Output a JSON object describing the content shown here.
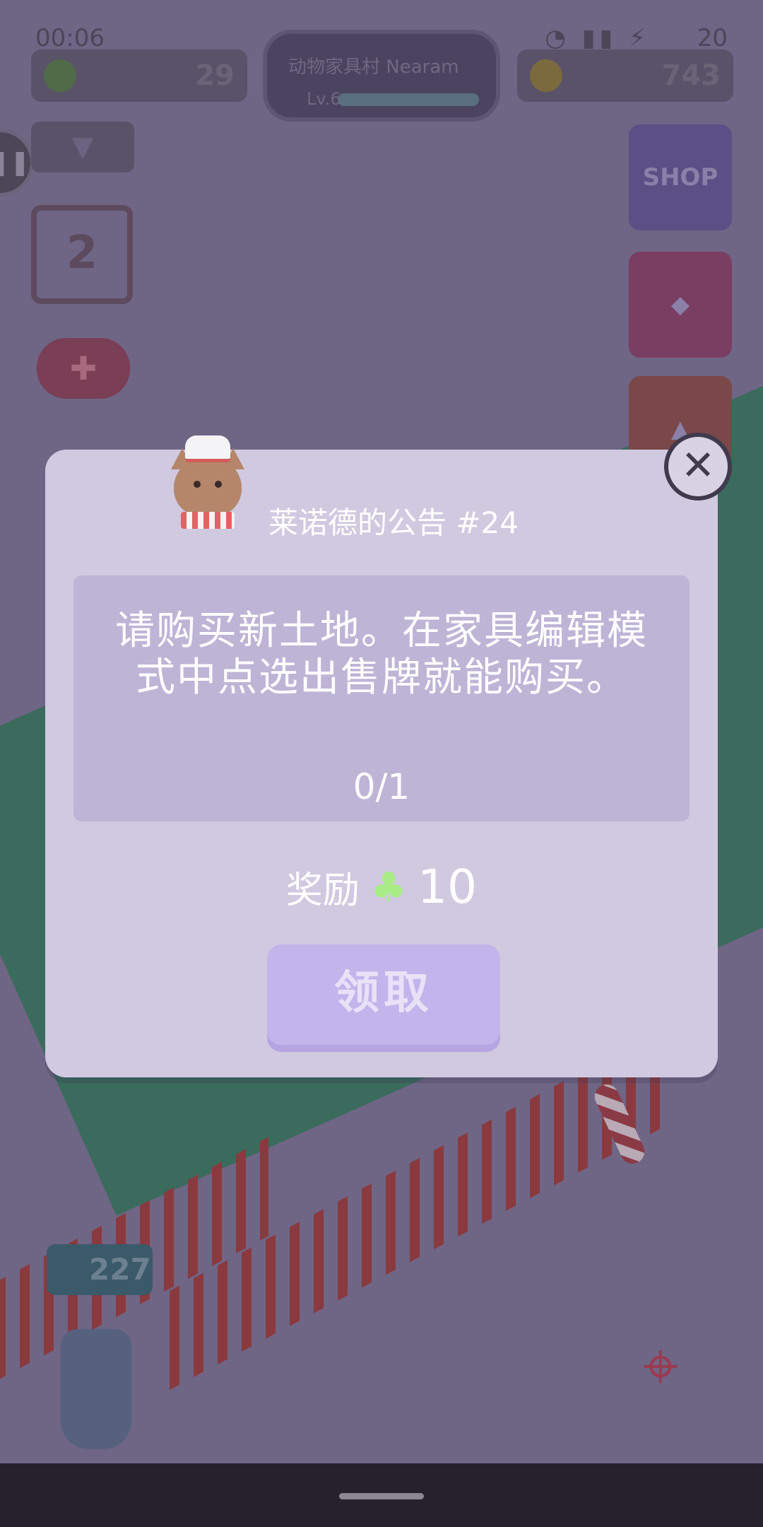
{
  "status_bar": {
    "time": "00:06",
    "battery": "20",
    "icons": "∞ ✉"
  },
  "hud": {
    "clover_count": "29",
    "coin_count": "743",
    "level_name": "动物家具村 Nearam",
    "level_label": "Lv.6"
  },
  "side_buttons": {
    "shop_label": "SHOP"
  },
  "scene": {
    "calendar_day": "2",
    "coin_badge": "227"
  },
  "dialog": {
    "title": "莱诺德的公告 #24",
    "task_text": "请购买新土地。在家具编辑模式中点选出售牌就能购买。",
    "progress": "0/1",
    "reward_label": "奖励",
    "reward_icon": "clover-icon",
    "reward_amount": "10",
    "claim_label": "领取",
    "close_label": "✕"
  },
  "colors": {
    "overlay": "#5b5470",
    "dialog_bg": "#d0c9e0",
    "task_box": "#bdb4d6",
    "claim_button": "#c4b4ec",
    "clover": "#a9ec87"
  }
}
